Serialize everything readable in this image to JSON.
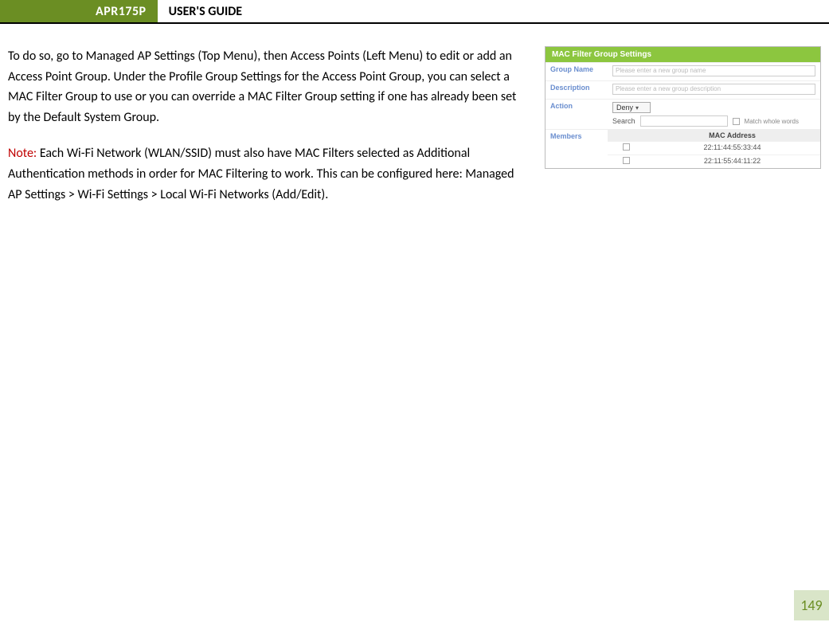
{
  "header": {
    "model": "APR175P",
    "title": "USER'S GUIDE"
  },
  "body": {
    "para1": "To do so, go to Managed AP Settings (Top Menu), then Access Points (Left Menu) to edit or add an Access Point Group. Under the Profile Group Settings for the Access Point Group, you can select a MAC Filter Group to use or you can override a MAC Filter Group setting if one has already been set by the Default System Group.",
    "note_label": "Note:",
    "note_text": " Each Wi-Fi Network (WLAN/SSID) must also have MAC Filters selected as Additional Authentication methods in order for MAC Filtering to work. This can be configured here: Managed AP Settings > Wi-Fi Settings > Local Wi-Fi Networks (Add/Edit)."
  },
  "figure": {
    "title": "MAC Filter Group Settings",
    "labels": {
      "group_name": "Group Name",
      "description": "Description",
      "action": "Action",
      "members": "Members",
      "search": "Search",
      "match_whole": "Match whole words",
      "mac_header": "MAC Address"
    },
    "placeholders": {
      "group_name": "Please enter a new group name",
      "description": "Please enter a new group description"
    },
    "action_value": "Deny",
    "rows": [
      "22:11:44:55:33:44",
      "22:11:55:44:11:22"
    ]
  },
  "page_number": "149"
}
